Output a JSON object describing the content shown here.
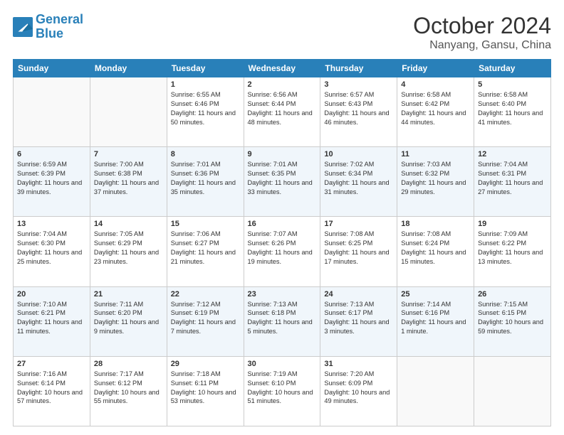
{
  "logo": {
    "text_general": "General",
    "text_blue": "Blue"
  },
  "title": "October 2024",
  "location": "Nanyang, Gansu, China",
  "weekdays": [
    "Sunday",
    "Monday",
    "Tuesday",
    "Wednesday",
    "Thursday",
    "Friday",
    "Saturday"
  ],
  "weeks": [
    [
      {
        "day": "",
        "empty": true
      },
      {
        "day": "",
        "empty": true
      },
      {
        "day": "1",
        "sunrise": "Sunrise: 6:55 AM",
        "sunset": "Sunset: 6:46 PM",
        "daylight": "Daylight: 11 hours and 50 minutes."
      },
      {
        "day": "2",
        "sunrise": "Sunrise: 6:56 AM",
        "sunset": "Sunset: 6:44 PM",
        "daylight": "Daylight: 11 hours and 48 minutes."
      },
      {
        "day": "3",
        "sunrise": "Sunrise: 6:57 AM",
        "sunset": "Sunset: 6:43 PM",
        "daylight": "Daylight: 11 hours and 46 minutes."
      },
      {
        "day": "4",
        "sunrise": "Sunrise: 6:58 AM",
        "sunset": "Sunset: 6:42 PM",
        "daylight": "Daylight: 11 hours and 44 minutes."
      },
      {
        "day": "5",
        "sunrise": "Sunrise: 6:58 AM",
        "sunset": "Sunset: 6:40 PM",
        "daylight": "Daylight: 11 hours and 41 minutes."
      }
    ],
    [
      {
        "day": "6",
        "sunrise": "Sunrise: 6:59 AM",
        "sunset": "Sunset: 6:39 PM",
        "daylight": "Daylight: 11 hours and 39 minutes."
      },
      {
        "day": "7",
        "sunrise": "Sunrise: 7:00 AM",
        "sunset": "Sunset: 6:38 PM",
        "daylight": "Daylight: 11 hours and 37 minutes."
      },
      {
        "day": "8",
        "sunrise": "Sunrise: 7:01 AM",
        "sunset": "Sunset: 6:36 PM",
        "daylight": "Daylight: 11 hours and 35 minutes."
      },
      {
        "day": "9",
        "sunrise": "Sunrise: 7:01 AM",
        "sunset": "Sunset: 6:35 PM",
        "daylight": "Daylight: 11 hours and 33 minutes."
      },
      {
        "day": "10",
        "sunrise": "Sunrise: 7:02 AM",
        "sunset": "Sunset: 6:34 PM",
        "daylight": "Daylight: 11 hours and 31 minutes."
      },
      {
        "day": "11",
        "sunrise": "Sunrise: 7:03 AM",
        "sunset": "Sunset: 6:32 PM",
        "daylight": "Daylight: 11 hours and 29 minutes."
      },
      {
        "day": "12",
        "sunrise": "Sunrise: 7:04 AM",
        "sunset": "Sunset: 6:31 PM",
        "daylight": "Daylight: 11 hours and 27 minutes."
      }
    ],
    [
      {
        "day": "13",
        "sunrise": "Sunrise: 7:04 AM",
        "sunset": "Sunset: 6:30 PM",
        "daylight": "Daylight: 11 hours and 25 minutes."
      },
      {
        "day": "14",
        "sunrise": "Sunrise: 7:05 AM",
        "sunset": "Sunset: 6:29 PM",
        "daylight": "Daylight: 11 hours and 23 minutes."
      },
      {
        "day": "15",
        "sunrise": "Sunrise: 7:06 AM",
        "sunset": "Sunset: 6:27 PM",
        "daylight": "Daylight: 11 hours and 21 minutes."
      },
      {
        "day": "16",
        "sunrise": "Sunrise: 7:07 AM",
        "sunset": "Sunset: 6:26 PM",
        "daylight": "Daylight: 11 hours and 19 minutes."
      },
      {
        "day": "17",
        "sunrise": "Sunrise: 7:08 AM",
        "sunset": "Sunset: 6:25 PM",
        "daylight": "Daylight: 11 hours and 17 minutes."
      },
      {
        "day": "18",
        "sunrise": "Sunrise: 7:08 AM",
        "sunset": "Sunset: 6:24 PM",
        "daylight": "Daylight: 11 hours and 15 minutes."
      },
      {
        "day": "19",
        "sunrise": "Sunrise: 7:09 AM",
        "sunset": "Sunset: 6:22 PM",
        "daylight": "Daylight: 11 hours and 13 minutes."
      }
    ],
    [
      {
        "day": "20",
        "sunrise": "Sunrise: 7:10 AM",
        "sunset": "Sunset: 6:21 PM",
        "daylight": "Daylight: 11 hours and 11 minutes."
      },
      {
        "day": "21",
        "sunrise": "Sunrise: 7:11 AM",
        "sunset": "Sunset: 6:20 PM",
        "daylight": "Daylight: 11 hours and 9 minutes."
      },
      {
        "day": "22",
        "sunrise": "Sunrise: 7:12 AM",
        "sunset": "Sunset: 6:19 PM",
        "daylight": "Daylight: 11 hours and 7 minutes."
      },
      {
        "day": "23",
        "sunrise": "Sunrise: 7:13 AM",
        "sunset": "Sunset: 6:18 PM",
        "daylight": "Daylight: 11 hours and 5 minutes."
      },
      {
        "day": "24",
        "sunrise": "Sunrise: 7:13 AM",
        "sunset": "Sunset: 6:17 PM",
        "daylight": "Daylight: 11 hours and 3 minutes."
      },
      {
        "day": "25",
        "sunrise": "Sunrise: 7:14 AM",
        "sunset": "Sunset: 6:16 PM",
        "daylight": "Daylight: 11 hours and 1 minute."
      },
      {
        "day": "26",
        "sunrise": "Sunrise: 7:15 AM",
        "sunset": "Sunset: 6:15 PM",
        "daylight": "Daylight: 10 hours and 59 minutes."
      }
    ],
    [
      {
        "day": "27",
        "sunrise": "Sunrise: 7:16 AM",
        "sunset": "Sunset: 6:14 PM",
        "daylight": "Daylight: 10 hours and 57 minutes."
      },
      {
        "day": "28",
        "sunrise": "Sunrise: 7:17 AM",
        "sunset": "Sunset: 6:12 PM",
        "daylight": "Daylight: 10 hours and 55 minutes."
      },
      {
        "day": "29",
        "sunrise": "Sunrise: 7:18 AM",
        "sunset": "Sunset: 6:11 PM",
        "daylight": "Daylight: 10 hours and 53 minutes."
      },
      {
        "day": "30",
        "sunrise": "Sunrise: 7:19 AM",
        "sunset": "Sunset: 6:10 PM",
        "daylight": "Daylight: 10 hours and 51 minutes."
      },
      {
        "day": "31",
        "sunrise": "Sunrise: 7:20 AM",
        "sunset": "Sunset: 6:09 PM",
        "daylight": "Daylight: 10 hours and 49 minutes."
      },
      {
        "day": "",
        "empty": true
      },
      {
        "day": "",
        "empty": true
      }
    ]
  ]
}
